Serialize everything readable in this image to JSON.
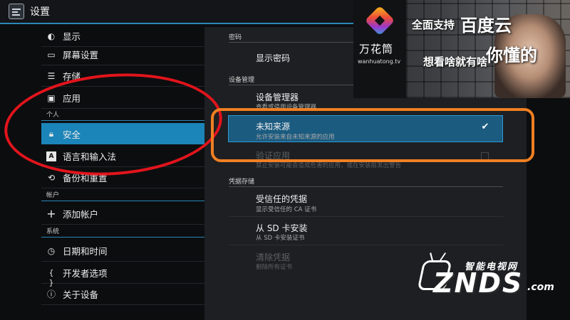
{
  "window": {
    "title": "设置"
  },
  "left_menu": {
    "items_top": [
      {
        "label": "显示",
        "icon": "brightness-icon"
      },
      {
        "label": "屏幕设置",
        "icon": "monitor-icon"
      },
      {
        "label": "存储",
        "icon": "storage-icon"
      },
      {
        "label": "应用",
        "icon": "apps-icon"
      }
    ],
    "section_personal": "个人",
    "security_label": "安全",
    "language_label": "语言和输入法",
    "backup_label": "备份和重置",
    "section_accounts": "帐户",
    "add_account_label": "添加帐户",
    "section_system": "系统",
    "datetime_label": "日期和时间",
    "developer_label": "开发者选项",
    "about_label": "关于设备"
  },
  "right_panel": {
    "password_header": "密码",
    "show_password_title": "显示密码",
    "device_admin_header": "设备管理",
    "device_manager_title": "设备管理器",
    "device_manager_sub": "查看或停用设备管理器",
    "unknown_sources_title": "未知来源",
    "unknown_sources_sub": "允许安装来自未知来源的应用",
    "unknown_sources_checked": true,
    "verify_apps_title": "验证应用",
    "verify_apps_sub": "禁止安装可能会造成危害的应用，或在安装前发出警告",
    "credential_header": "凭据存储",
    "trusted_creds_title": "受信任的凭据",
    "trusted_creds_sub": "显示受信任的 CA 证书",
    "install_sd_title": "从 SD 卡安装",
    "install_sd_sub": "从 SD 卡安装证书",
    "clear_creds_title": "清除凭据",
    "clear_creds_sub": "删除所有证书"
  },
  "ad_banner": {
    "brand": "万花筒",
    "url": "wanhuatong.tv",
    "line1": "全面支持",
    "line1_big": "百度云",
    "line2": "想看啥就有啥",
    "line2_big": "你懂的"
  },
  "watermark": {
    "cn_text": "智能电视网",
    "main_text": "ZNDS",
    "suffix": ".com"
  },
  "colors": {
    "accent": "#1b84b8",
    "annotation_red": "#e2141c",
    "annotation_orange": "#f07f22"
  }
}
